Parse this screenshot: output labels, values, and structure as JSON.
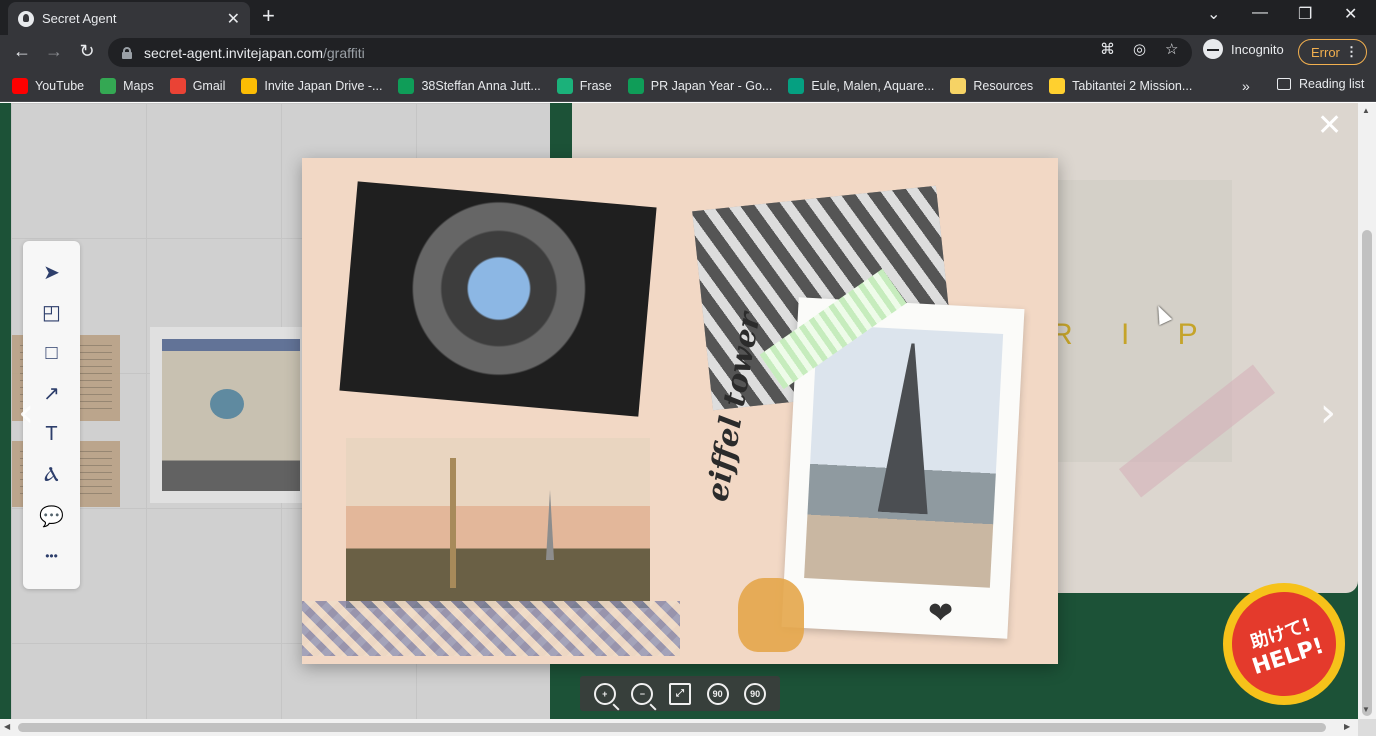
{
  "browser": {
    "tab_title": "Secret Agent",
    "new_tab": "+",
    "url_host": "secret-agent.invitejapan.com",
    "url_path": "/graffiti",
    "incognito_label": "Incognito",
    "error_label": "Error",
    "window_controls": {
      "chevron": "⌄",
      "minimize": "—",
      "restore": "❐",
      "close": "✕"
    }
  },
  "bookmarks": [
    {
      "label": "YouTube",
      "icon": "youtube-icon",
      "color": "#ff0000"
    },
    {
      "label": "Maps",
      "icon": "maps-icon",
      "color": "#34a853"
    },
    {
      "label": "Gmail",
      "icon": "gmail-icon",
      "color": "#ea4335"
    },
    {
      "label": "Invite Japan Drive -...",
      "icon": "drive-icon",
      "color": "#fbbc04"
    },
    {
      "label": "38Steffan Anna Jutt...",
      "icon": "sheets-icon",
      "color": "#0f9d58"
    },
    {
      "label": "Frase",
      "icon": "frase-icon",
      "color": "#1bb17a"
    },
    {
      "label": "PR Japan Year - Go...",
      "icon": "sheets-icon",
      "color": "#0f9d58"
    },
    {
      "label": "Eule, Malen, Aquare...",
      "icon": "pexels-icon",
      "color": "#05a081"
    },
    {
      "label": "Resources",
      "icon": "folder-icon",
      "color": "#f6d365"
    },
    {
      "label": "Tabitantei 2 Mission...",
      "icon": "miro-icon",
      "color": "#ffd02f"
    }
  ],
  "bookmarks_more": "»",
  "reading_list": "Reading list",
  "page": {
    "trip_text": "R I P",
    "lightbox": {
      "handwritten_text": "eiffel tower",
      "heart": "❤",
      "zoom_controls": {
        "zoom_in": "+",
        "zoom_out": "−",
        "fit": "⤢",
        "rotate_left": "90",
        "rotate_right": "90"
      }
    },
    "nav_prev": "‹",
    "nav_next": "›",
    "close": "✕",
    "help_badge": {
      "jp": "助けて!",
      "en": "HELP!"
    }
  },
  "tools": [
    {
      "name": "select-tool",
      "glyph": "➤"
    },
    {
      "name": "sticky-note-tool",
      "glyph": "◰"
    },
    {
      "name": "rectangle-tool",
      "glyph": "□"
    },
    {
      "name": "arrow-tool",
      "glyph": "↗"
    },
    {
      "name": "text-tool",
      "glyph": "T"
    },
    {
      "name": "pen-tool",
      "glyph": "Ⲁ"
    },
    {
      "name": "comment-tool",
      "glyph": "💬"
    },
    {
      "name": "more-tool",
      "glyph": "•••"
    }
  ],
  "scrollbars": {
    "up": "▲",
    "down": "▼",
    "left": "◀",
    "right": "▶"
  }
}
